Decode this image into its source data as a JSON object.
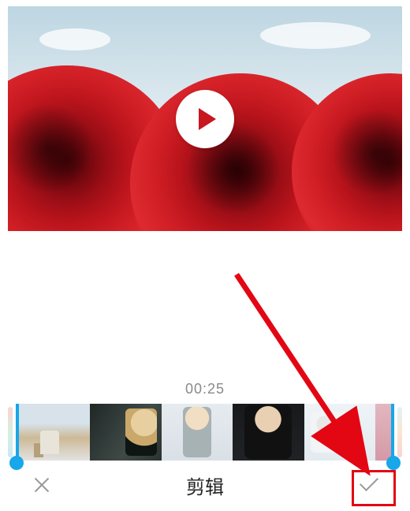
{
  "preview": {
    "play_icon_name": "play-icon"
  },
  "timeline": {
    "timestamp": "00:25",
    "accent_color": "#17a7ea",
    "handle_left": "trim-handle-left",
    "handle_right": "trim-handle-right",
    "thumbs": [
      "frame-0",
      "frame-1",
      "frame-2",
      "frame-3",
      "frame-4",
      "frame-5"
    ]
  },
  "bottombar": {
    "close_label": "",
    "title": "剪辑",
    "confirm_label": ""
  },
  "annotation": {
    "target": "confirm-button"
  }
}
